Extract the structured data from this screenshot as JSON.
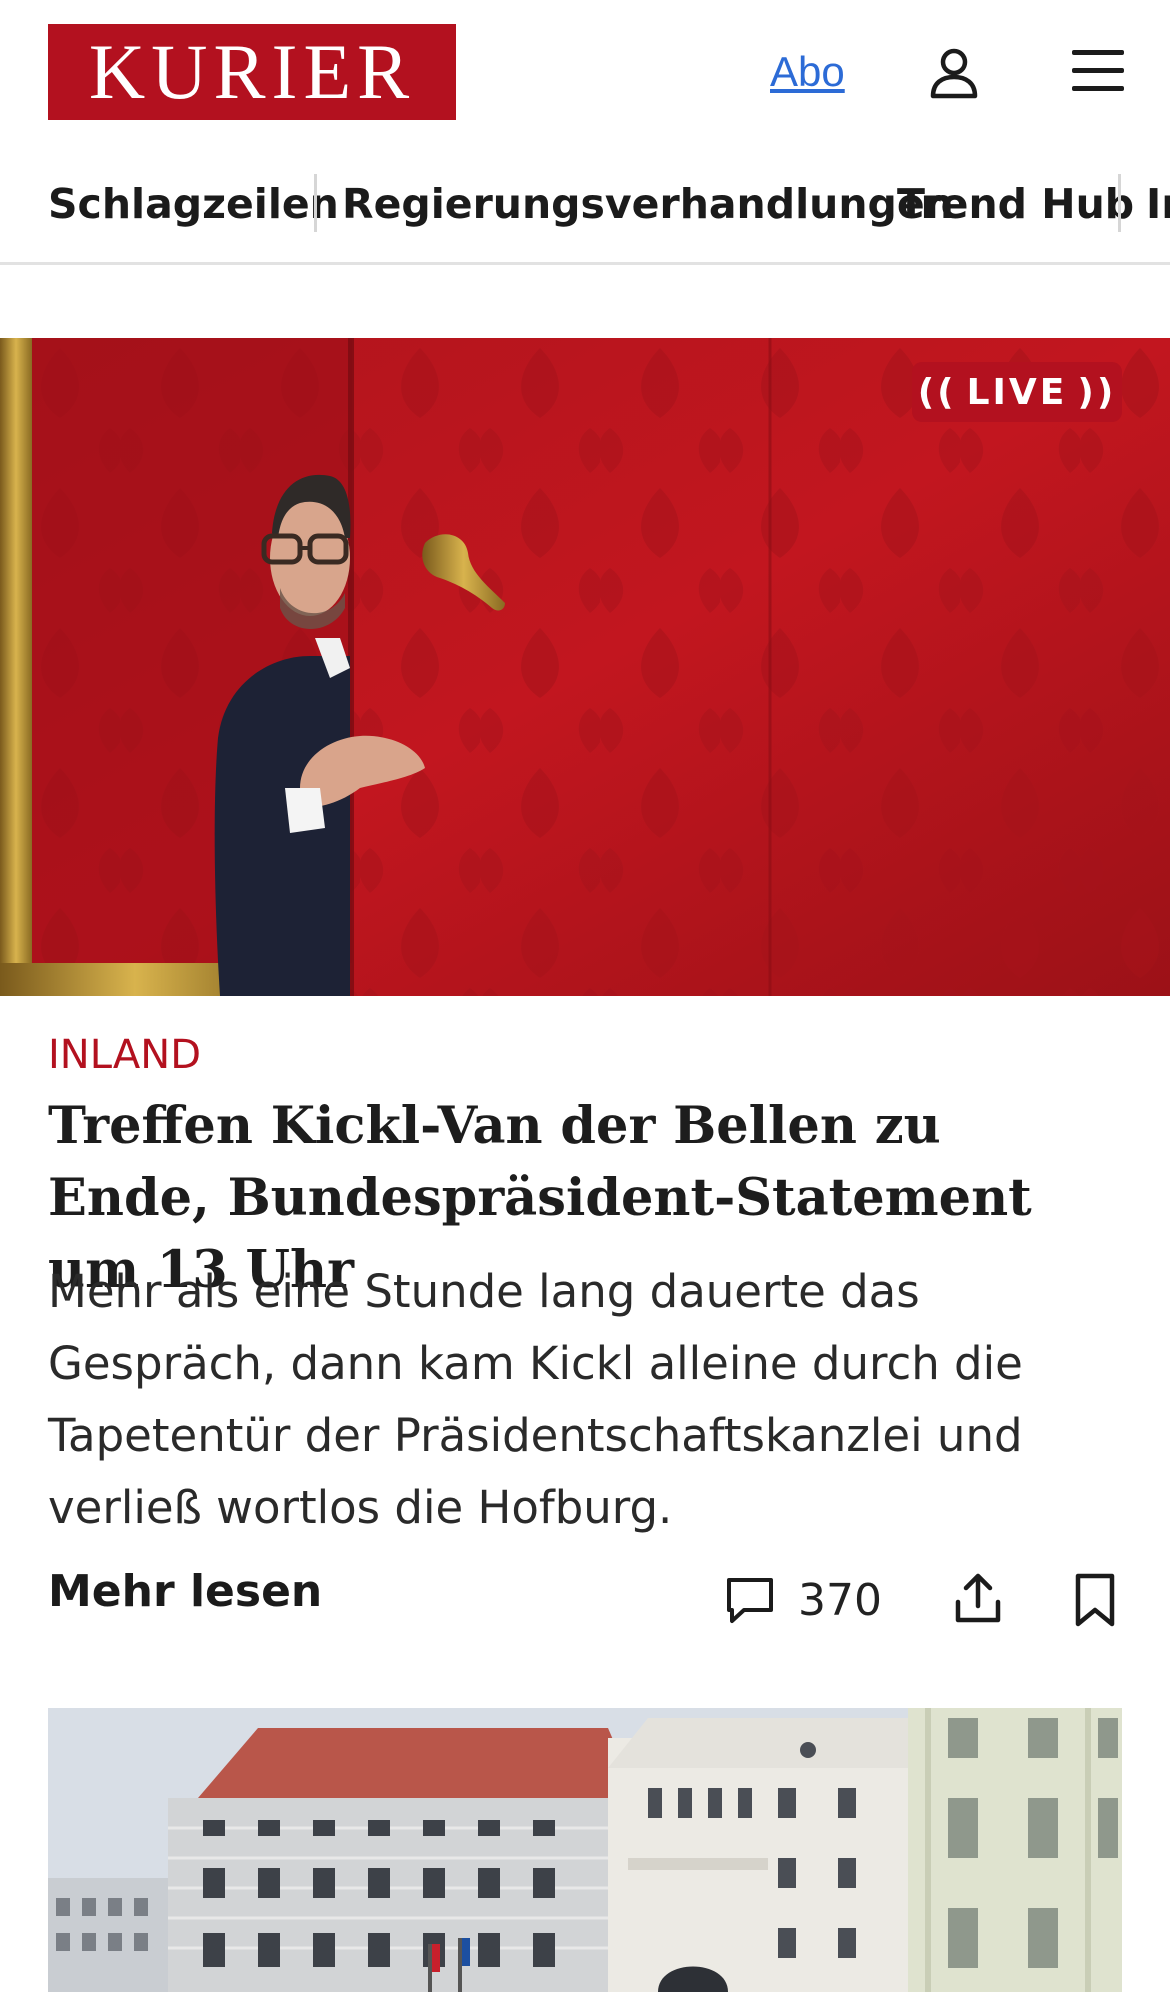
{
  "header": {
    "logo_text": "KURIER",
    "abo_label": "Abo",
    "user_icon": "user-icon",
    "menu_icon": "hamburger-menu-icon",
    "brand_color": "#b3111f",
    "link_color": "#2c6bd6"
  },
  "nav": {
    "items": [
      {
        "label": "Schlagzeilen"
      },
      {
        "label": "Regierungsverhandlungen"
      },
      {
        "label": "Trend Hub"
      },
      {
        "label": "In"
      }
    ]
  },
  "hero": {
    "live_label": "LIVE",
    "image_alt": "Man in a suit peeking out from behind a red damask door with a gold handle"
  },
  "article": {
    "kicker": "INLAND",
    "headline": "Treffen Kickl-Van der Bellen zu Ende, Bundespräsident-Statement um 13 Uhr",
    "teaser": "Mehr als eine Stunde lang dauerte das Gespräch, dann kam Kickl alleine durch die Tapetentür der Präsidentschaftskanzlei und verließ wortlos die Hofburg.",
    "more_label": "Mehr lesen",
    "comment_count": "370",
    "comment_icon": "comment-icon",
    "share_icon": "share-icon",
    "bookmark_icon": "bookmark-icon"
  },
  "second_article": {
    "image_alt": "Hofburg building facade in Vienna"
  }
}
